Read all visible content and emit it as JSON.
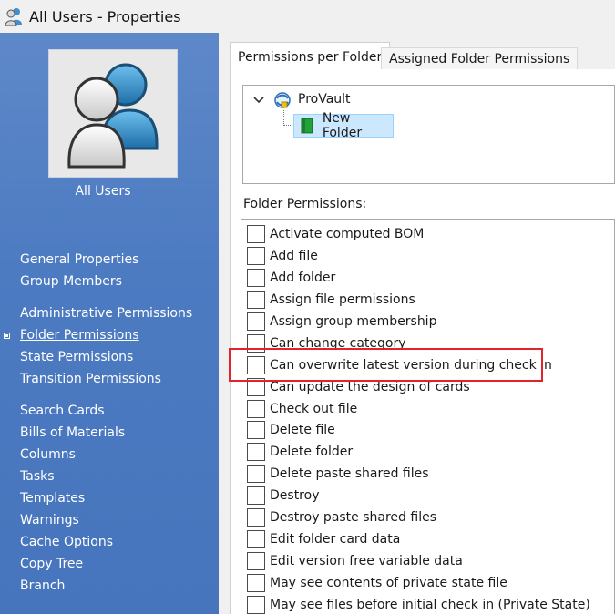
{
  "window": {
    "title": "All Users - Properties",
    "icon": "users-group-icon"
  },
  "profile": {
    "label": "All Users",
    "avatar_icon": "user-group-avatar-icon"
  },
  "nav": {
    "items": [
      {
        "label": "General Properties",
        "active": false
      },
      {
        "label": "Group Members",
        "active": false
      },
      {
        "label": "Administrative Permissions",
        "active": false
      },
      {
        "label": "Folder Permissions",
        "active": true
      },
      {
        "label": "State Permissions",
        "active": false
      },
      {
        "label": "Transition Permissions",
        "active": false
      },
      {
        "label": "Search Cards",
        "active": false
      },
      {
        "label": "Bills of Materials",
        "active": false
      },
      {
        "label": "Columns",
        "active": false
      },
      {
        "label": "Tasks",
        "active": false
      },
      {
        "label": "Templates",
        "active": false
      },
      {
        "label": "Warnings",
        "active": false
      },
      {
        "label": "Cache Options",
        "active": false
      },
      {
        "label": "Copy Tree",
        "active": false
      },
      {
        "label": "Branch",
        "active": false
      }
    ]
  },
  "tabs": [
    {
      "label": "Permissions per Folder",
      "active": true
    },
    {
      "label": "Assigned Folder Permissions",
      "active": false
    }
  ],
  "tree": {
    "root": {
      "label": "ProVault",
      "icon": "vault-icon",
      "expanded": true
    },
    "selected_child": {
      "label": "New Folder",
      "icon": "folder-icon"
    }
  },
  "folder_permissions": {
    "label": "Folder Permissions:",
    "items": [
      {
        "label": "Activate computed BOM",
        "checked": false
      },
      {
        "label": "Add file",
        "checked": false
      },
      {
        "label": "Add folder",
        "checked": false
      },
      {
        "label": "Assign file permissions",
        "checked": false
      },
      {
        "label": "Assign group membership",
        "checked": false
      },
      {
        "label": "Can change category",
        "checked": false
      },
      {
        "label": "Can overwrite latest version during check in",
        "checked": false,
        "highlighted": true
      },
      {
        "label": "Can update the design of cards",
        "checked": false
      },
      {
        "label": "Check out file",
        "checked": false
      },
      {
        "label": "Delete file",
        "checked": false
      },
      {
        "label": "Delete folder",
        "checked": false
      },
      {
        "label": "Delete paste shared files",
        "checked": false
      },
      {
        "label": "Destroy",
        "checked": false
      },
      {
        "label": "Destroy paste shared files",
        "checked": false
      },
      {
        "label": "Edit folder card data",
        "checked": false
      },
      {
        "label": "Edit version free variable data",
        "checked": false
      },
      {
        "label": "May see contents of private state file",
        "checked": false
      },
      {
        "label": "May see files before initial check in (Private State)",
        "checked": false
      }
    ]
  },
  "colors": {
    "nav_background": "#4d7bc2",
    "highlight_border": "#e0242b",
    "selection_background": "#cce8ff"
  }
}
